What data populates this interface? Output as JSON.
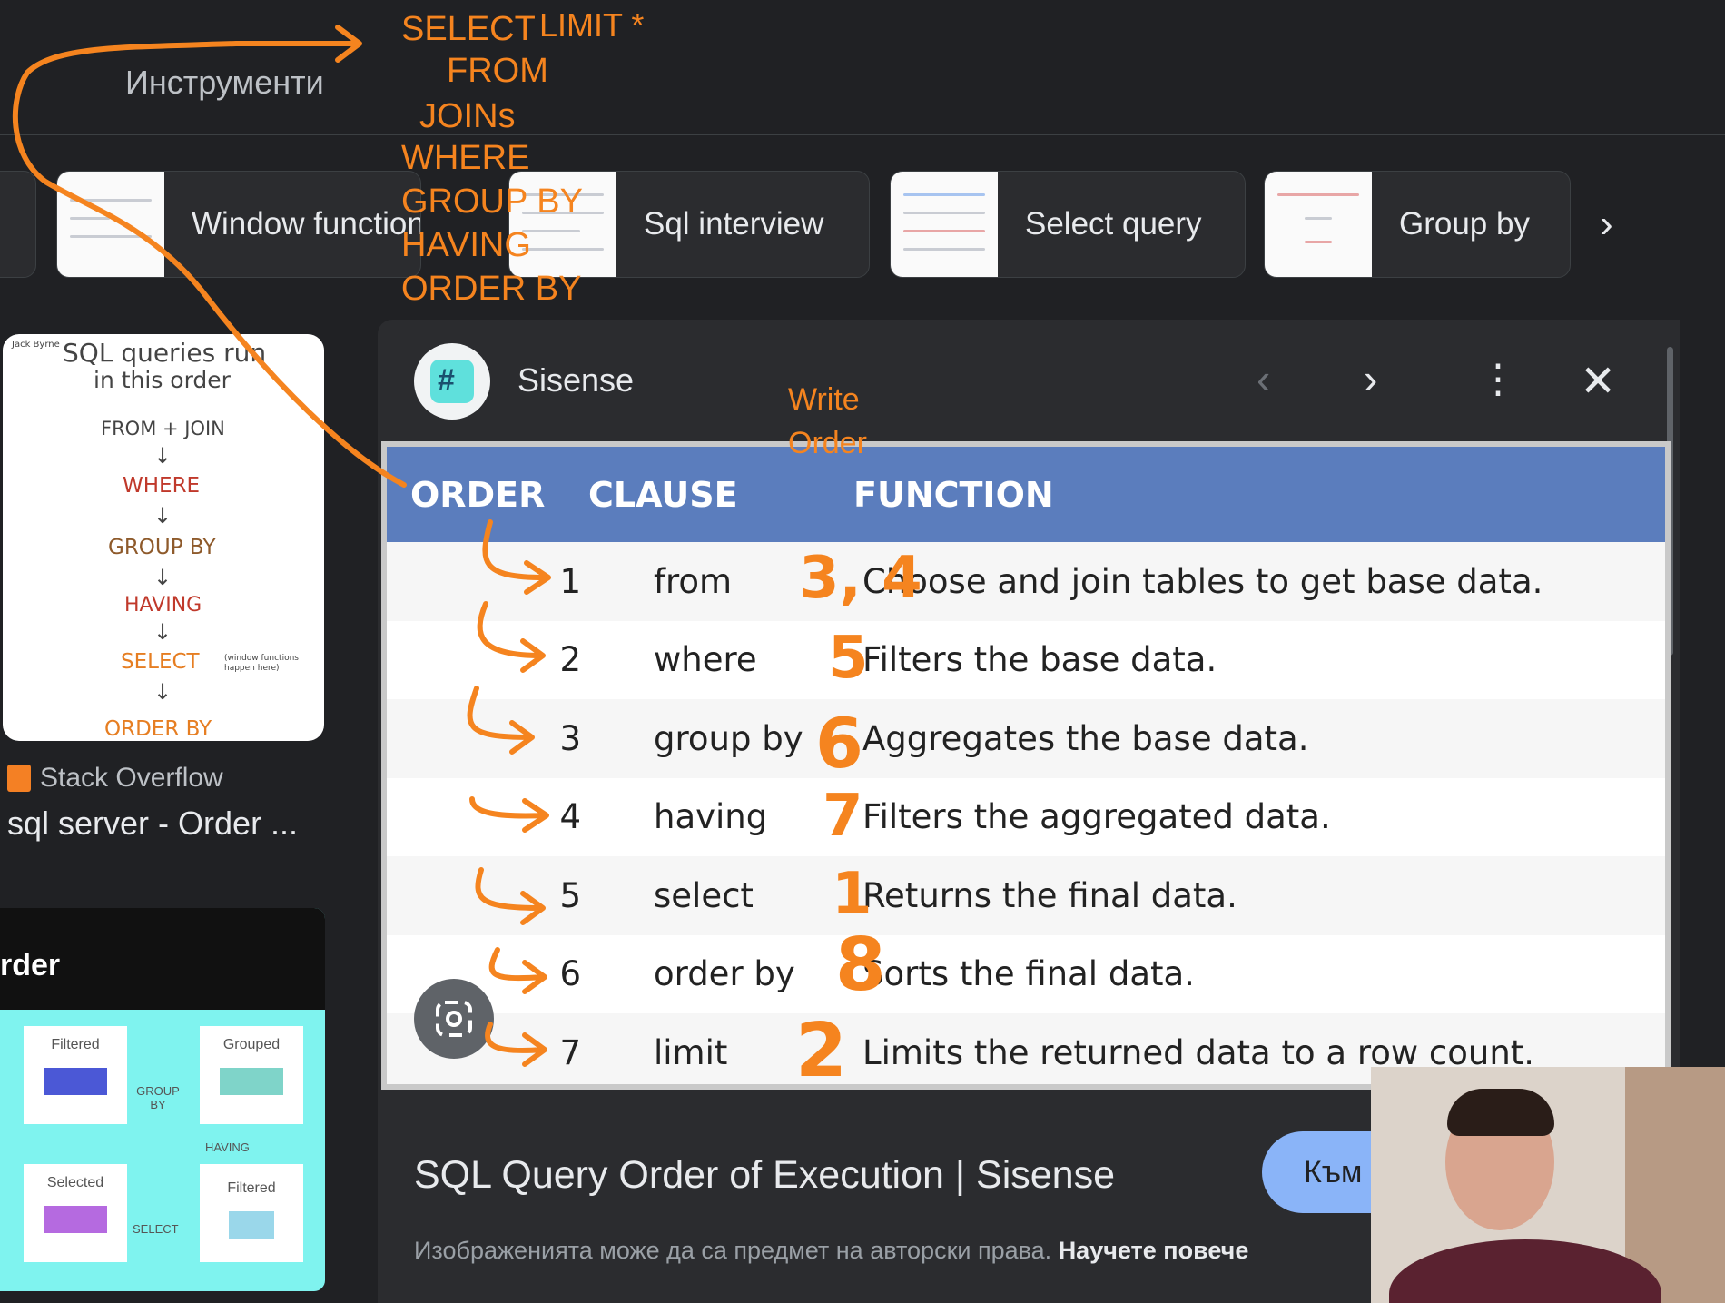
{
  "toolbar": {
    "tools_label": "Инструменти"
  },
  "chips": [
    {
      "label": "Window functions"
    },
    {
      "label": "Sql interview"
    },
    {
      "label": "Select query"
    },
    {
      "label": "Group by"
    }
  ],
  "left_result": {
    "card_text": [
      "SQL queries run",
      "in this order",
      "FROM + JOIN",
      "WHERE",
      "GROUP BY",
      "HAVING",
      "SELECT",
      "(window functions happen here)",
      "ORDER BY"
    ],
    "card_corner": "Jack Byrne",
    "source": "Stack Overflow",
    "title": "sql server - Order ..."
  },
  "left_result2": {
    "header": "rder",
    "boxes": [
      "Filtered",
      "Grouped",
      "Selected",
      "Filtered"
    ],
    "arrows": [
      "GROUP BY",
      "HAVING",
      "SELECT"
    ]
  },
  "viewer": {
    "source_name": "Sisense",
    "table": {
      "headers": [
        "ORDER",
        "CLAUSE",
        "FUNCTION"
      ],
      "rows": [
        {
          "order": "1",
          "clause": "from",
          "function": "Choose and join tables to get base data."
        },
        {
          "order": "2",
          "clause": "where",
          "function": "Filters the base data."
        },
        {
          "order": "3",
          "clause": "group by",
          "function": "Aggregates the base data."
        },
        {
          "order": "4",
          "clause": "having",
          "function": "Filters the aggregated data."
        },
        {
          "order": "5",
          "clause": "select",
          "function": "Returns the final data."
        },
        {
          "order": "6",
          "clause": "order by",
          "function": "Sorts the final data."
        },
        {
          "order": "7",
          "clause": "limit",
          "function": "Limits the returned data to a row count."
        }
      ]
    },
    "title": "SQL Query Order of Execution | Sisense",
    "visit_button": "Към",
    "copyright": "Изображенията може да са предмет на авторски права.",
    "learn_more": "Научете повече"
  },
  "annotations": {
    "write_order_lines": [
      "SELECT",
      "LIMIT *",
      "FROM",
      "JOINs",
      "WHERE",
      "GROUP BY",
      "HAVING",
      "ORDER BY"
    ],
    "write_label": "Write",
    "order_label": "Order",
    "write_numbers": [
      "3, 4",
      "5",
      "6",
      "7",
      "1",
      "8",
      "2"
    ],
    "ink_color": "#f5841f"
  }
}
